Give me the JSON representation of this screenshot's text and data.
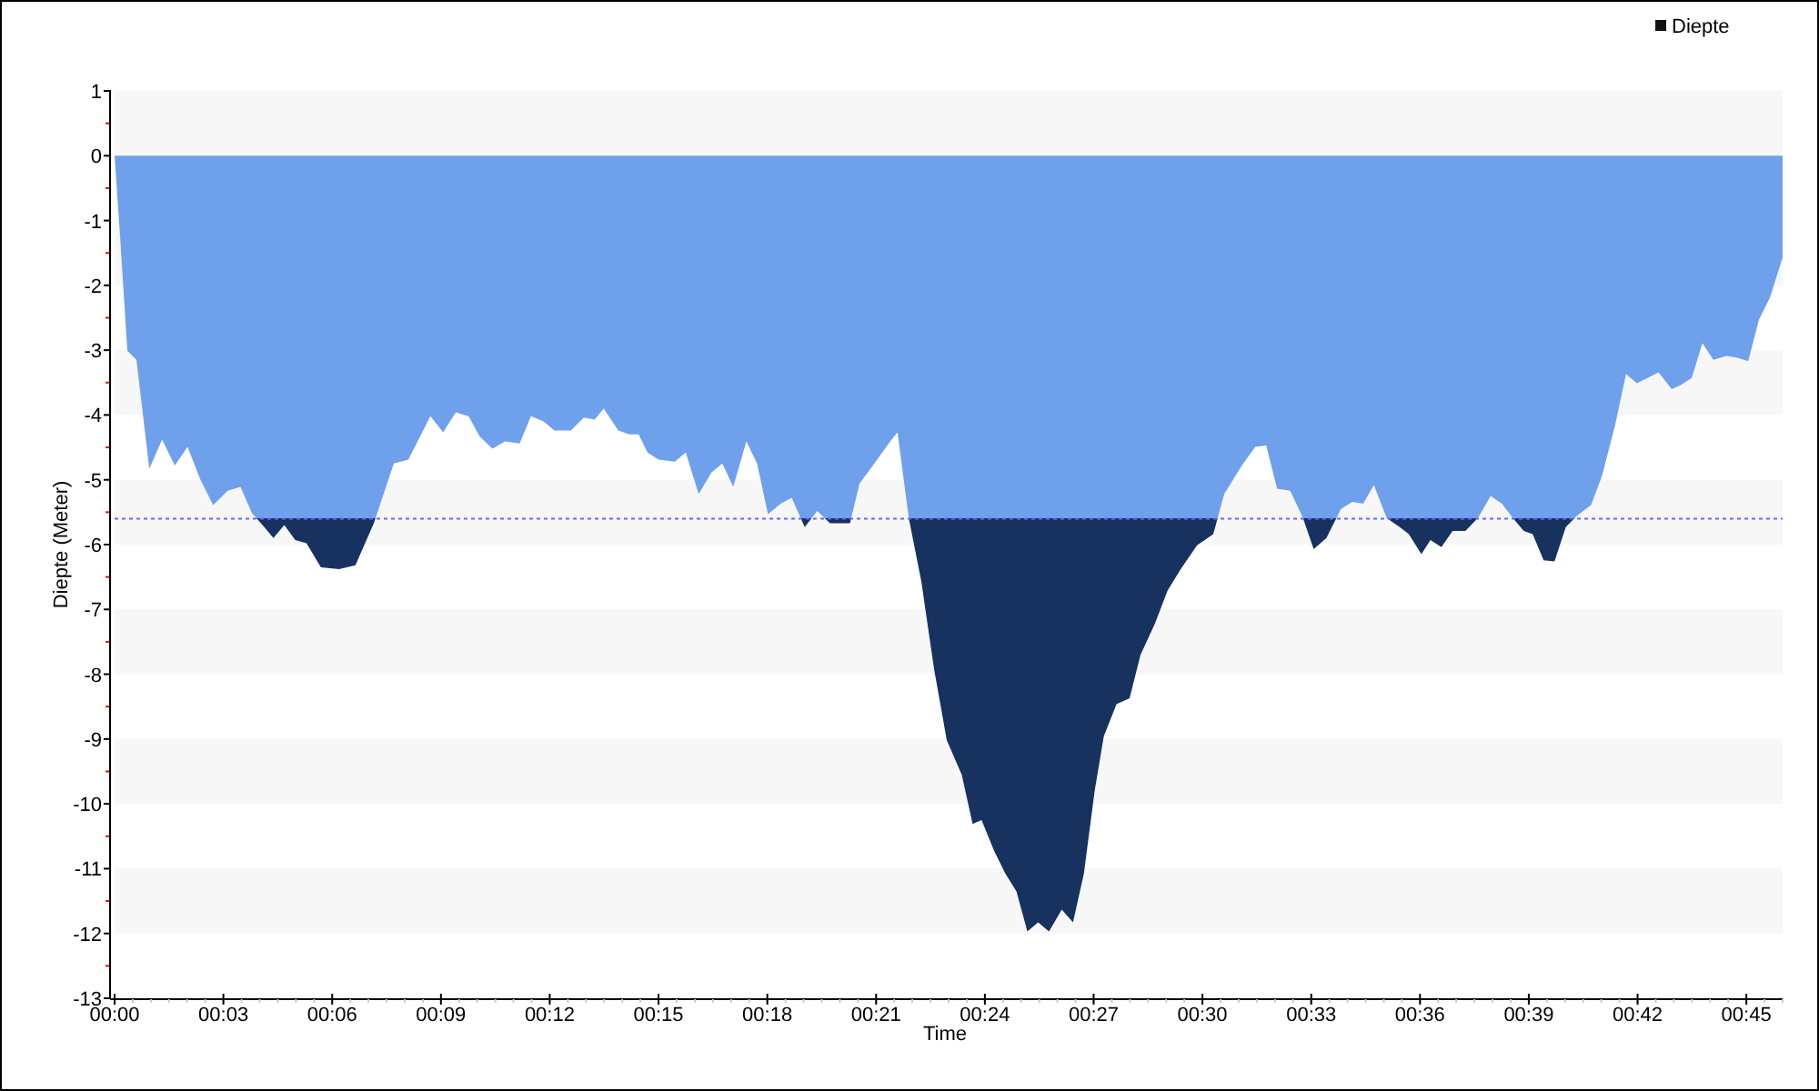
{
  "chart": {
    "chart_data": {
      "type": "area",
      "xlabel": "Time",
      "ylabel": "Diepte (Meter)",
      "xlim": [
        0,
        46
      ],
      "ylim": [
        -13,
        1
      ],
      "xticks": [
        {
          "value": 0,
          "label": "00:00"
        },
        {
          "value": 3,
          "label": "00:03"
        },
        {
          "value": 6,
          "label": "00:06"
        },
        {
          "value": 9,
          "label": "00:09"
        },
        {
          "value": 12,
          "label": "00:12"
        },
        {
          "value": 15,
          "label": "00:15"
        },
        {
          "value": 18,
          "label": "00:18"
        },
        {
          "value": 21,
          "label": "00:21"
        },
        {
          "value": 24,
          "label": "00:24"
        },
        {
          "value": 27,
          "label": "00:27"
        },
        {
          "value": 30,
          "label": "00:30"
        },
        {
          "value": 33,
          "label": "00:33"
        },
        {
          "value": 36,
          "label": "00:36"
        },
        {
          "value": 39,
          "label": "00:39"
        },
        {
          "value": 42,
          "label": "00:42"
        },
        {
          "value": 45,
          "label": "00:45"
        }
      ],
      "yticks": [
        1,
        0,
        -1,
        -2,
        -3,
        -4,
        -5,
        -6,
        -7,
        -8,
        -9,
        -10,
        -11,
        -12,
        -13
      ],
      "x": [
        0,
        0.15,
        0.35,
        0.6,
        0.96,
        1.31,
        1.66,
        2.01,
        2.37,
        2.72,
        3.12,
        3.47,
        3.78,
        4.13,
        4.38,
        4.68,
        4.98,
        5.29,
        5.69,
        6.19,
        6.64,
        7.15,
        7.7,
        8.1,
        8.71,
        9.06,
        9.41,
        9.76,
        10.07,
        10.42,
        10.77,
        11.17,
        11.48,
        11.83,
        12.13,
        12.58,
        12.94,
        13.24,
        13.49,
        13.89,
        14.19,
        14.45,
        14.7,
        15,
        15.45,
        15.75,
        16.11,
        16.46,
        16.76,
        17.06,
        17.42,
        17.72,
        18.02,
        18.37,
        18.67,
        19.03,
        19.38,
        19.73,
        20.28,
        20.54,
        20.99,
        21.39,
        21.59,
        21.9,
        22.25,
        22.6,
        22.95,
        23.36,
        23.66,
        23.91,
        24.26,
        24.56,
        24.87,
        25.17,
        25.47,
        25.77,
        26.12,
        26.43,
        26.73,
        27.03,
        27.28,
        27.63,
        27.99,
        28.29,
        28.69,
        29.04,
        29.4,
        29.85,
        30.3,
        30.6,
        31.06,
        31.46,
        31.76,
        32.06,
        32.42,
        32.77,
        33.07,
        33.42,
        33.82,
        34.13,
        34.43,
        34.73,
        35.08,
        35.44,
        35.69,
        36.04,
        36.29,
        36.59,
        36.9,
        37.25,
        37.6,
        37.95,
        38.26,
        38.56,
        38.86,
        39.11,
        39.41,
        39.71,
        40.02,
        40.32,
        40.72,
        41.02,
        41.38,
        41.68,
        41.98,
        42.28,
        42.58,
        42.94,
        43.19,
        43.49,
        43.79,
        44.09,
        44.45,
        44.75,
        45.05,
        45.35,
        45.65,
        46
      ],
      "series": [
        {
          "name": "Diepte",
          "color": "#6fa0ec",
          "values": [
            0,
            -1.24,
            -3.01,
            -3.15,
            -4.83,
            -4.38,
            -4.78,
            -4.49,
            -5,
            -5.39,
            -5.17,
            -5.11,
            -5.51,
            -5.73,
            -5.9,
            -5.7,
            -5.93,
            -5.98,
            -6.35,
            -6.38,
            -6.32,
            -5.67,
            -4.75,
            -4.69,
            -4.02,
            -4.27,
            -3.96,
            -4.02,
            -4.33,
            -4.52,
            -4.41,
            -4.44,
            -4.02,
            -4.1,
            -4.24,
            -4.24,
            -4.04,
            -4.07,
            -3.9,
            -4.24,
            -4.3,
            -4.3,
            -4.58,
            -4.69,
            -4.72,
            -4.58,
            -5.22,
            -4.89,
            -4.75,
            -5.11,
            -4.41,
            -4.75,
            -5.53,
            -5.37,
            -5.28,
            -5.73,
            -5.48,
            -5.67,
            -5.67,
            -5.06,
            -4.72,
            -4.41,
            -4.27,
            -5.59,
            -6.57,
            -7.92,
            -9.02,
            -9.55,
            -10.31,
            -10.25,
            -10.73,
            -11.07,
            -11.35,
            -11.97,
            -11.83,
            -11.97,
            -11.63,
            -11.83,
            -11.07,
            -9.8,
            -8.96,
            -8.46,
            -8.37,
            -7.7,
            -7.22,
            -6.71,
            -6.38,
            -6.01,
            -5.84,
            -5.22,
            -4.8,
            -4.49,
            -4.47,
            -5.14,
            -5.17,
            -5.59,
            -6.07,
            -5.9,
            -5.45,
            -5.34,
            -5.37,
            -5.08,
            -5.59,
            -5.73,
            -5.84,
            -6.15,
            -5.93,
            -6.04,
            -5.79,
            -5.79,
            -5.59,
            -5.25,
            -5.37,
            -5.59,
            -5.79,
            -5.84,
            -6.24,
            -6.26,
            -5.73,
            -5.56,
            -5.39,
            -4.94,
            -4.16,
            -3.37,
            -3.51,
            -3.43,
            -3.34,
            -3.6,
            -3.54,
            -3.43,
            -2.89,
            -3.15,
            -3.09,
            -3.12,
            -3.17,
            -2.53,
            -2.19,
            -1.57
          ]
        }
      ],
      "ref_lines": [
        {
          "axis": "y",
          "value": -5.6,
          "color": "#6666ff"
        }
      ]
    }
  }
}
